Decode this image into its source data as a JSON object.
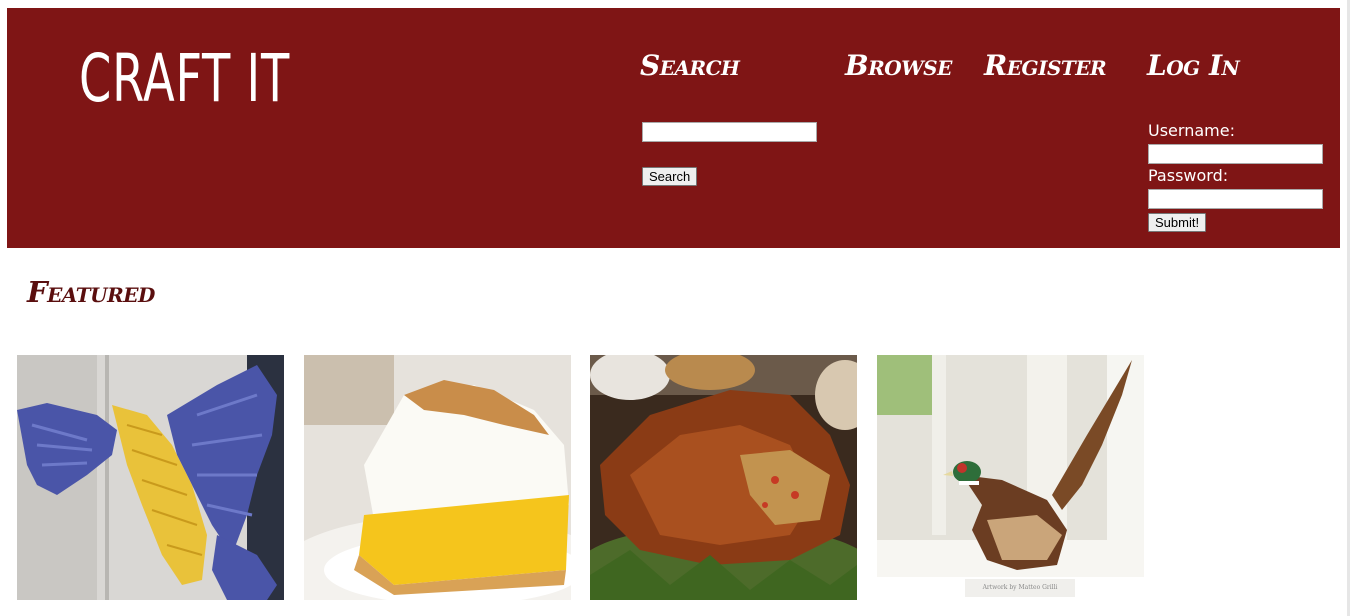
{
  "header": {
    "logo": "CRAFT IT",
    "nav": {
      "search": "Search",
      "browse": "Browse",
      "register": "Register",
      "login": "Log In"
    },
    "search": {
      "value": "",
      "button_label": "Search"
    },
    "login": {
      "username_label": "Username:",
      "username_value": "",
      "password_label": "Password:",
      "password_value": "",
      "submit_label": "Submit!"
    }
  },
  "featured": {
    "title": "Featured",
    "items": [
      {
        "subject": "paper-wings"
      },
      {
        "subject": "lemon-meringue-pie"
      },
      {
        "subject": "roast-turkey"
      },
      {
        "subject": "paper-pheasant",
        "caption": "Artwork by Matteo Grilli"
      }
    ]
  },
  "colors": {
    "header_bg": "#7f1515",
    "featured_title": "#5a0e0e"
  }
}
